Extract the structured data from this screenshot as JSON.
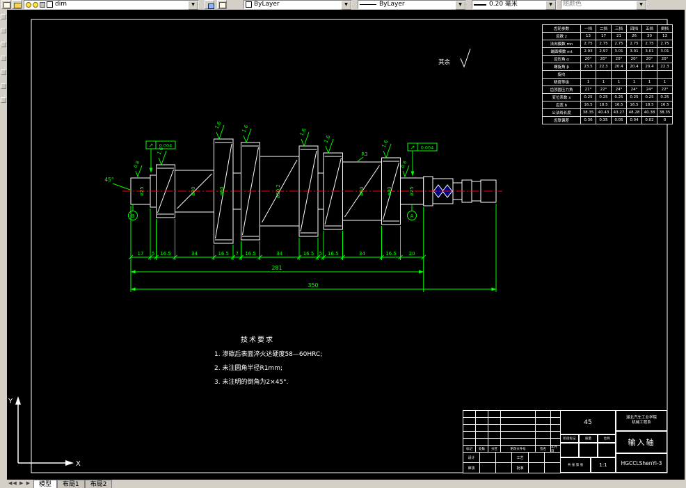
{
  "toolbar": {
    "layer_value": "dim",
    "color_value": "ByLayer",
    "linetype_value": "ByLayer",
    "lineweight_value": "0.20 毫米",
    "plotstyle_value": "随颜色"
  },
  "statusbar": {
    "tabs": [
      "模型",
      "布局1",
      "布局2"
    ]
  },
  "sheet": {
    "general_note_label": "其余",
    "tech_requirements": {
      "title": "技术要求",
      "items": [
        "1. 渗碳后表面淬火达硬度58—60HRC;",
        "2. 未注圆角半径R1mm;",
        "3. 未注明的倒角为2×45°."
      ]
    },
    "param_table": {
      "corner": "齿轮参数",
      "columns": [
        "一挡",
        "二挡",
        "三挡",
        "四挡",
        "五挡",
        "倒挡"
      ],
      "rows": [
        {
          "label": "齿数 z",
          "values": [
            "13",
            "17",
            "21",
            "26",
            "30",
            "13"
          ]
        },
        {
          "label": "法向模数 mn",
          "values": [
            "2.75",
            "2.75",
            "2.75",
            "2.75",
            "2.75",
            "2.75"
          ]
        },
        {
          "label": "端面模数 mt",
          "values": [
            "2.93",
            "2.97",
            "3.01",
            "3.01",
            "3.01",
            "3.01"
          ]
        },
        {
          "label": "齿形角 α",
          "values": [
            "20°",
            "20°",
            "20°",
            "20°",
            "20°",
            "20°"
          ]
        },
        {
          "label": "螺旋角 β",
          "values": [
            "23.5",
            "22.3",
            "20.4",
            "20.4",
            "20.4",
            "22.3"
          ]
        },
        {
          "label": "旋向",
          "values": [
            "",
            "",
            "",
            "",
            "",
            ""
          ]
        },
        {
          "label": "精度等级",
          "values": [
            "1",
            "1",
            "1",
            "1",
            "1",
            "1"
          ]
        },
        {
          "label": "齿顶圆压力角",
          "values": [
            "21°",
            "22°",
            "24°",
            "24°",
            "24°",
            "22°"
          ]
        },
        {
          "label": "变位系数 x",
          "values": [
            "0.25",
            "0.25",
            "0.25",
            "0.25",
            "0.25",
            "0.25"
          ]
        },
        {
          "label": "齿宽 b",
          "values": [
            "16.5",
            "18.5",
            "16.5",
            "16.5",
            "18.5",
            "16.5"
          ]
        },
        {
          "label": "公法线长度",
          "values": [
            "38.35",
            "40.43",
            "43.27",
            "48.28",
            "40.38",
            "38.35"
          ]
        },
        {
          "label": "齿厚偏差",
          "values": [
            "0.36",
            "0.35",
            "0.05",
            "0.04",
            "0.02",
            "0"
          ]
        }
      ]
    },
    "dimensions": {
      "chain": [
        "17",
        "5",
        "16.5",
        "34",
        "16.5",
        "7",
        "16.5",
        "34",
        "16.5",
        "5",
        "16.5",
        "34",
        "16.5",
        "20"
      ],
      "overall_inner": "281",
      "overall_total": "350"
    },
    "annotations": {
      "chamfer": "45°",
      "fillet": "R3",
      "datum_left": "B",
      "datum_right": "A",
      "tolerance_frames": [
        {
          "symbol": "↗",
          "value": "0.004"
        },
        {
          "symbol": "↗",
          "value": "0.004"
        }
      ],
      "roughness_gear": [
        "1.6",
        "1.6",
        "1.6",
        "1.6",
        "1.6",
        "1.6"
      ],
      "roughness_journal": [
        "0.8",
        "0.8"
      ],
      "diameters": [
        "ø25",
        "ø30",
        "ø60",
        "ø50.2",
        "ø50",
        "ø40",
        "ø25"
      ]
    },
    "title_block": {
      "school_line1": "湖北汽车工业学院",
      "school_line2": "机械工程系",
      "material": "45",
      "part_name": "输入轴",
      "drawing_number": "HGCCLShenYi-3",
      "scale": "1:1",
      "revision_labels": [
        "标记",
        "处数",
        "分区",
        "更改文件号",
        "签名",
        "年月日"
      ],
      "role_labels": [
        "设计",
        "工艺",
        "审核",
        "批准"
      ],
      "stage_label": "阶段标记",
      "mass_label": "质量",
      "scale_label": "比例",
      "sheet_label": "共 张 第 张"
    },
    "ucs": {
      "x_label": "X",
      "y_label": "Y"
    }
  }
}
